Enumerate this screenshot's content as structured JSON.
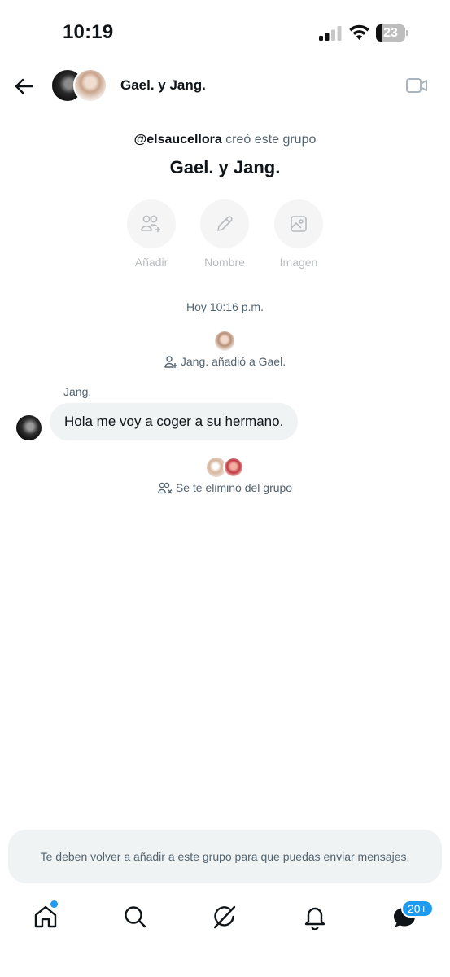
{
  "status_bar": {
    "time": "10:19",
    "battery_level": "23",
    "battery_fraction": 0.23
  },
  "header": {
    "title": "Gael. y Jang.",
    "icons": [
      "back-arrow-icon",
      "video-camera-icon"
    ]
  },
  "group_intro": {
    "creator_handle": "@elsaucellora",
    "creator_suffix": " creó este grupo",
    "group_name": "Gael. y Jang.",
    "actions": [
      {
        "label": "Añadir",
        "icon": "add-people-icon"
      },
      {
        "label": "Nombre",
        "icon": "pencil-icon"
      },
      {
        "label": "Imagen",
        "icon": "image-icon"
      }
    ]
  },
  "conversation": {
    "timestamp": "Hoy 10:16 p.m.",
    "event_added": "Jang. añadió a Gael.",
    "sender_name": "Jang.",
    "message_text": "Hola me voy a coger a su hermano.",
    "event_removed": "Se te eliminó del grupo"
  },
  "notice": {
    "text": "Te deben volver a añadir a este grupo para que puedas enviar mensajes."
  },
  "bottom_nav": {
    "items": [
      "home-icon",
      "search-icon",
      "grok-icon",
      "notifications-icon",
      "messages-icon"
    ],
    "messages_badge": "20+",
    "accent_color": "#1d9bf0"
  }
}
